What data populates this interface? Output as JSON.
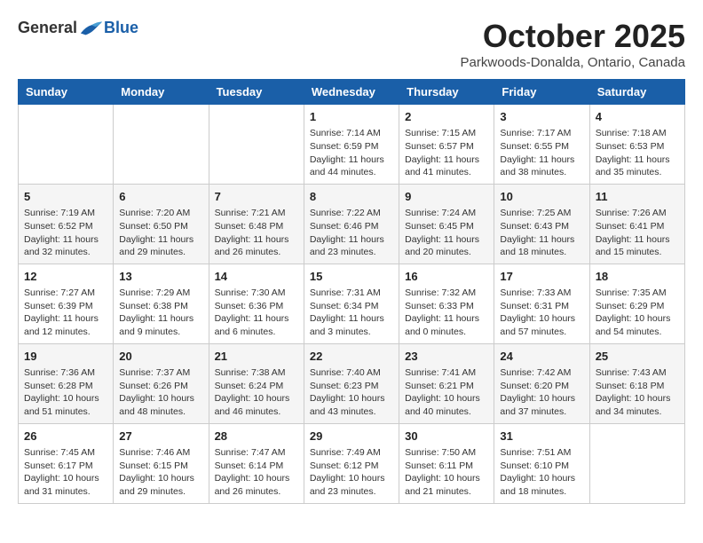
{
  "header": {
    "logo_general": "General",
    "logo_blue": "Blue",
    "month_title": "October 2025",
    "location": "Parkwoods-Donalda, Ontario, Canada"
  },
  "days_of_week": [
    "Sunday",
    "Monday",
    "Tuesday",
    "Wednesday",
    "Thursday",
    "Friday",
    "Saturday"
  ],
  "weeks": [
    [
      {
        "day": "",
        "sunrise": "",
        "sunset": "",
        "daylight": ""
      },
      {
        "day": "",
        "sunrise": "",
        "sunset": "",
        "daylight": ""
      },
      {
        "day": "",
        "sunrise": "",
        "sunset": "",
        "daylight": ""
      },
      {
        "day": "1",
        "sunrise": "Sunrise: 7:14 AM",
        "sunset": "Sunset: 6:59 PM",
        "daylight": "Daylight: 11 hours and 44 minutes."
      },
      {
        "day": "2",
        "sunrise": "Sunrise: 7:15 AM",
        "sunset": "Sunset: 6:57 PM",
        "daylight": "Daylight: 11 hours and 41 minutes."
      },
      {
        "day": "3",
        "sunrise": "Sunrise: 7:17 AM",
        "sunset": "Sunset: 6:55 PM",
        "daylight": "Daylight: 11 hours and 38 minutes."
      },
      {
        "day": "4",
        "sunrise": "Sunrise: 7:18 AM",
        "sunset": "Sunset: 6:53 PM",
        "daylight": "Daylight: 11 hours and 35 minutes."
      }
    ],
    [
      {
        "day": "5",
        "sunrise": "Sunrise: 7:19 AM",
        "sunset": "Sunset: 6:52 PM",
        "daylight": "Daylight: 11 hours and 32 minutes."
      },
      {
        "day": "6",
        "sunrise": "Sunrise: 7:20 AM",
        "sunset": "Sunset: 6:50 PM",
        "daylight": "Daylight: 11 hours and 29 minutes."
      },
      {
        "day": "7",
        "sunrise": "Sunrise: 7:21 AM",
        "sunset": "Sunset: 6:48 PM",
        "daylight": "Daylight: 11 hours and 26 minutes."
      },
      {
        "day": "8",
        "sunrise": "Sunrise: 7:22 AM",
        "sunset": "Sunset: 6:46 PM",
        "daylight": "Daylight: 11 hours and 23 minutes."
      },
      {
        "day": "9",
        "sunrise": "Sunrise: 7:24 AM",
        "sunset": "Sunset: 6:45 PM",
        "daylight": "Daylight: 11 hours and 20 minutes."
      },
      {
        "day": "10",
        "sunrise": "Sunrise: 7:25 AM",
        "sunset": "Sunset: 6:43 PM",
        "daylight": "Daylight: 11 hours and 18 minutes."
      },
      {
        "day": "11",
        "sunrise": "Sunrise: 7:26 AM",
        "sunset": "Sunset: 6:41 PM",
        "daylight": "Daylight: 11 hours and 15 minutes."
      }
    ],
    [
      {
        "day": "12",
        "sunrise": "Sunrise: 7:27 AM",
        "sunset": "Sunset: 6:39 PM",
        "daylight": "Daylight: 11 hours and 12 minutes."
      },
      {
        "day": "13",
        "sunrise": "Sunrise: 7:29 AM",
        "sunset": "Sunset: 6:38 PM",
        "daylight": "Daylight: 11 hours and 9 minutes."
      },
      {
        "day": "14",
        "sunrise": "Sunrise: 7:30 AM",
        "sunset": "Sunset: 6:36 PM",
        "daylight": "Daylight: 11 hours and 6 minutes."
      },
      {
        "day": "15",
        "sunrise": "Sunrise: 7:31 AM",
        "sunset": "Sunset: 6:34 PM",
        "daylight": "Daylight: 11 hours and 3 minutes."
      },
      {
        "day": "16",
        "sunrise": "Sunrise: 7:32 AM",
        "sunset": "Sunset: 6:33 PM",
        "daylight": "Daylight: 11 hours and 0 minutes."
      },
      {
        "day": "17",
        "sunrise": "Sunrise: 7:33 AM",
        "sunset": "Sunset: 6:31 PM",
        "daylight": "Daylight: 10 hours and 57 minutes."
      },
      {
        "day": "18",
        "sunrise": "Sunrise: 7:35 AM",
        "sunset": "Sunset: 6:29 PM",
        "daylight": "Daylight: 10 hours and 54 minutes."
      }
    ],
    [
      {
        "day": "19",
        "sunrise": "Sunrise: 7:36 AM",
        "sunset": "Sunset: 6:28 PM",
        "daylight": "Daylight: 10 hours and 51 minutes."
      },
      {
        "day": "20",
        "sunrise": "Sunrise: 7:37 AM",
        "sunset": "Sunset: 6:26 PM",
        "daylight": "Daylight: 10 hours and 48 minutes."
      },
      {
        "day": "21",
        "sunrise": "Sunrise: 7:38 AM",
        "sunset": "Sunset: 6:24 PM",
        "daylight": "Daylight: 10 hours and 46 minutes."
      },
      {
        "day": "22",
        "sunrise": "Sunrise: 7:40 AM",
        "sunset": "Sunset: 6:23 PM",
        "daylight": "Daylight: 10 hours and 43 minutes."
      },
      {
        "day": "23",
        "sunrise": "Sunrise: 7:41 AM",
        "sunset": "Sunset: 6:21 PM",
        "daylight": "Daylight: 10 hours and 40 minutes."
      },
      {
        "day": "24",
        "sunrise": "Sunrise: 7:42 AM",
        "sunset": "Sunset: 6:20 PM",
        "daylight": "Daylight: 10 hours and 37 minutes."
      },
      {
        "day": "25",
        "sunrise": "Sunrise: 7:43 AM",
        "sunset": "Sunset: 6:18 PM",
        "daylight": "Daylight: 10 hours and 34 minutes."
      }
    ],
    [
      {
        "day": "26",
        "sunrise": "Sunrise: 7:45 AM",
        "sunset": "Sunset: 6:17 PM",
        "daylight": "Daylight: 10 hours and 31 minutes."
      },
      {
        "day": "27",
        "sunrise": "Sunrise: 7:46 AM",
        "sunset": "Sunset: 6:15 PM",
        "daylight": "Daylight: 10 hours and 29 minutes."
      },
      {
        "day": "28",
        "sunrise": "Sunrise: 7:47 AM",
        "sunset": "Sunset: 6:14 PM",
        "daylight": "Daylight: 10 hours and 26 minutes."
      },
      {
        "day": "29",
        "sunrise": "Sunrise: 7:49 AM",
        "sunset": "Sunset: 6:12 PM",
        "daylight": "Daylight: 10 hours and 23 minutes."
      },
      {
        "day": "30",
        "sunrise": "Sunrise: 7:50 AM",
        "sunset": "Sunset: 6:11 PM",
        "daylight": "Daylight: 10 hours and 21 minutes."
      },
      {
        "day": "31",
        "sunrise": "Sunrise: 7:51 AM",
        "sunset": "Sunset: 6:10 PM",
        "daylight": "Daylight: 10 hours and 18 minutes."
      },
      {
        "day": "",
        "sunrise": "",
        "sunset": "",
        "daylight": ""
      }
    ]
  ]
}
